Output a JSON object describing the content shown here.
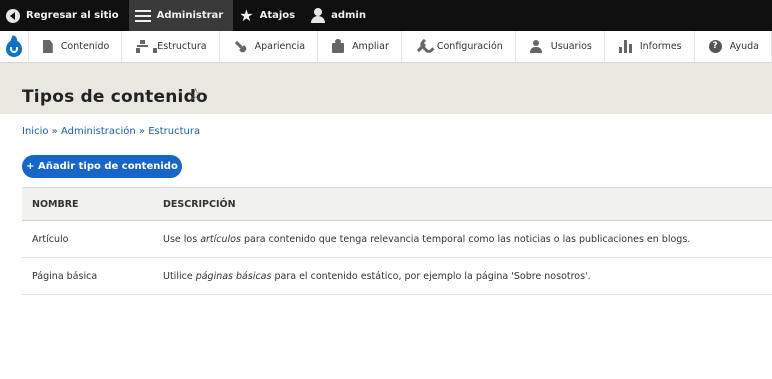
{
  "toolbar": {
    "back_label": "Regresar al sitio",
    "manage_label": "Administrar",
    "shortcuts_label": "Atajos",
    "user_label": "admin"
  },
  "tray": {
    "items": [
      {
        "label": "Contenido",
        "icon": "content-icon"
      },
      {
        "label": "Estructura",
        "icon": "structure-icon"
      },
      {
        "label": "Apariencia",
        "icon": "appearance-icon"
      },
      {
        "label": "Ampliar",
        "icon": "extend-icon"
      },
      {
        "label": "Configuración",
        "icon": "configuration-icon"
      },
      {
        "label": "Usuarios",
        "icon": "users-icon"
      },
      {
        "label": "Informes",
        "icon": "reports-icon"
      },
      {
        "label": "Ayuda",
        "icon": "help-icon"
      }
    ]
  },
  "page": {
    "title": "Tipos de contenido"
  },
  "breadcrumb": {
    "items": [
      "Inicio",
      "Administración",
      "Estructura"
    ],
    "separator": "»"
  },
  "actions": {
    "add_label": "+ Añadir tipo de contenido"
  },
  "table": {
    "headers": [
      "NOMBRE",
      "DESCRIPCIÓN"
    ],
    "rows": [
      {
        "name": "Artículo",
        "desc_pre": "Use los ",
        "desc_em": "artículos",
        "desc_post": " para contenido que tenga relevancia temporal como las noticias o las publicaciones en blogs."
      },
      {
        "name": "Página básica",
        "desc_pre": "Utilice ",
        "desc_em": "páginas básicas",
        "desc_post": " para el contenido estático, por ejemplo la página 'Sobre nosotros'."
      }
    ]
  },
  "colors": {
    "toolbar_bg": "#0f0f0f",
    "accent": "#1766c7",
    "link": "#1a5fa8",
    "header_bg": "#e8e8e1"
  }
}
